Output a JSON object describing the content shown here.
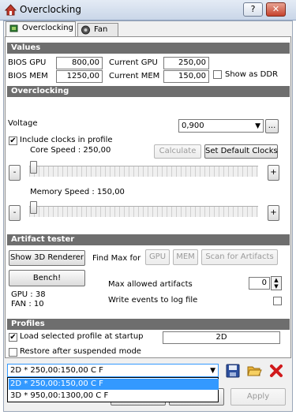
{
  "window": {
    "title": "Overclocking"
  },
  "tabs": [
    {
      "label": "Overclocking"
    },
    {
      "label": "Fan"
    }
  ],
  "values": {
    "header": "Values",
    "bios_gpu_label": "BIOS GPU",
    "bios_gpu": "800,00",
    "bios_mem_label": "BIOS MEM",
    "bios_mem": "1250,00",
    "current_gpu_label": "Current GPU",
    "current_gpu": "250,00",
    "current_mem_label": "Current MEM",
    "current_mem": "150,00",
    "show_ddr_label": "Show as DDR"
  },
  "overclocking": {
    "header": "Overclocking",
    "voltage_label": "Voltage",
    "voltage_value": "0,900",
    "more_btn": "...",
    "include_clocks_label": "Include clocks in profile",
    "core_speed_label": "Core Speed : 250,00",
    "calculate_btn": "Calculate",
    "set_default_btn": "Set Default Clocks",
    "minus": "-",
    "plus": "+",
    "memory_speed_label": "Memory Speed : 150,00",
    "core_slider_level": 0,
    "memory_slider_level": 0
  },
  "artifact": {
    "header": "Artifact tester",
    "show_3d_btn": "Show 3D Renderer",
    "find_max_label": "Find Max for",
    "gpu_btn": "GPU",
    "mem_btn": "MEM",
    "scan_btn": "Scan for Artifacts",
    "bench_btn": "Bench!",
    "max_allowed_label": "Max allowed artifacts",
    "max_allowed_value": "0",
    "write_events_label": "Write events to log file",
    "gpu_temp": "GPU : 38",
    "fan": "FAN : 10"
  },
  "profiles": {
    "header": "Profiles",
    "load_selected_label": "Load selected profile at startup",
    "startup_profile": "2D",
    "restore_label": "Restore after suspended mode",
    "selected_profile": "2D * 250,00:150,00 C  F",
    "options": [
      "2D * 250,00:150,00 C  F",
      "3D * 950,00:1300,00 C  F"
    ]
  },
  "footer": {
    "apply_btn": "Apply"
  }
}
